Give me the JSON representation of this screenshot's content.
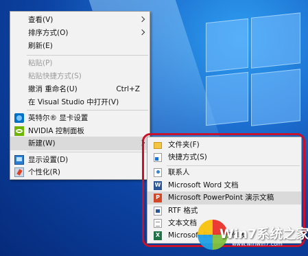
{
  "context_menu": {
    "items": [
      {
        "label": "查看(V)",
        "submenu": true
      },
      {
        "label": "排序方式(O)",
        "submenu": true
      },
      {
        "label": "刷新(E)"
      },
      {
        "label": "粘贴(P)",
        "disabled": true
      },
      {
        "label": "粘贴快捷方式(S)",
        "disabled": true
      },
      {
        "label": "撤消 重命名(U)",
        "shortcut": "Ctrl+Z"
      },
      {
        "label": "在 Visual Studio 中打开(V)"
      },
      {
        "label": "英特尔® 显卡设置",
        "icon": "intel-graphics-icon"
      },
      {
        "label": "NVIDIA 控制面板",
        "icon": "nvidia-icon"
      },
      {
        "label": "新建(W)",
        "submenu": true,
        "highlighted": true
      },
      {
        "label": "显示设置(D)",
        "icon": "display-settings-icon"
      },
      {
        "label": "个性化(R)",
        "icon": "personalize-icon"
      }
    ]
  },
  "new_submenu": {
    "items": [
      {
        "label": "文件夹(F)",
        "icon": "folder-icon"
      },
      {
        "label": "快捷方式(S)",
        "icon": "shortcut-icon"
      },
      {
        "label": "联系人",
        "icon": "contact-icon"
      },
      {
        "label": "Microsoft Word 文档",
        "icon": "word-icon"
      },
      {
        "label": "Microsoft PowerPoint 演示文稿",
        "icon": "powerpoint-icon",
        "highlighted": true
      },
      {
        "label": "RTF 格式",
        "icon": "rtf-icon"
      },
      {
        "label": "文本文档",
        "icon": "text-document-icon"
      },
      {
        "label": "Microsoft Excel 工作表",
        "icon": "excel-icon"
      }
    ]
  },
  "watermark": {
    "text": "Win7系统之家",
    "url": "www.winwin7.com"
  },
  "colors": {
    "highlight_ring": "#c8112a",
    "menu_bg": "#f2f2f2"
  }
}
